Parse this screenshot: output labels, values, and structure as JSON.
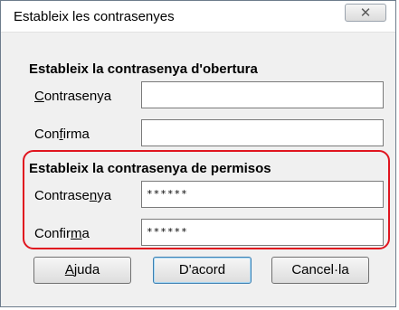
{
  "window": {
    "title": "Estableix les contrasenyes",
    "close_glyph": "✕"
  },
  "open_section": {
    "heading": "Estableix la contrasenya d'obertura",
    "password_label": {
      "pre": "",
      "u": "C",
      "post": "ontrasenya"
    },
    "password_value": "",
    "confirm_label": {
      "pre": "Con",
      "u": "f",
      "post": "irma"
    },
    "confirm_value": ""
  },
  "perm_section": {
    "heading": "Estableix la contrasenya de permisos",
    "password_label": {
      "pre": "Contrase",
      "u": "n",
      "post": "ya"
    },
    "password_value": "******",
    "confirm_label": {
      "pre": "Confir",
      "u": "m",
      "post": "a"
    },
    "confirm_value": "******"
  },
  "buttons": {
    "help": {
      "pre": "",
      "u": "A",
      "post": "juda"
    },
    "ok": "D'acord",
    "cancel": "Cancel·la"
  },
  "colors": {
    "highlight": "#e0151f",
    "accent": "#3c7fb1"
  }
}
